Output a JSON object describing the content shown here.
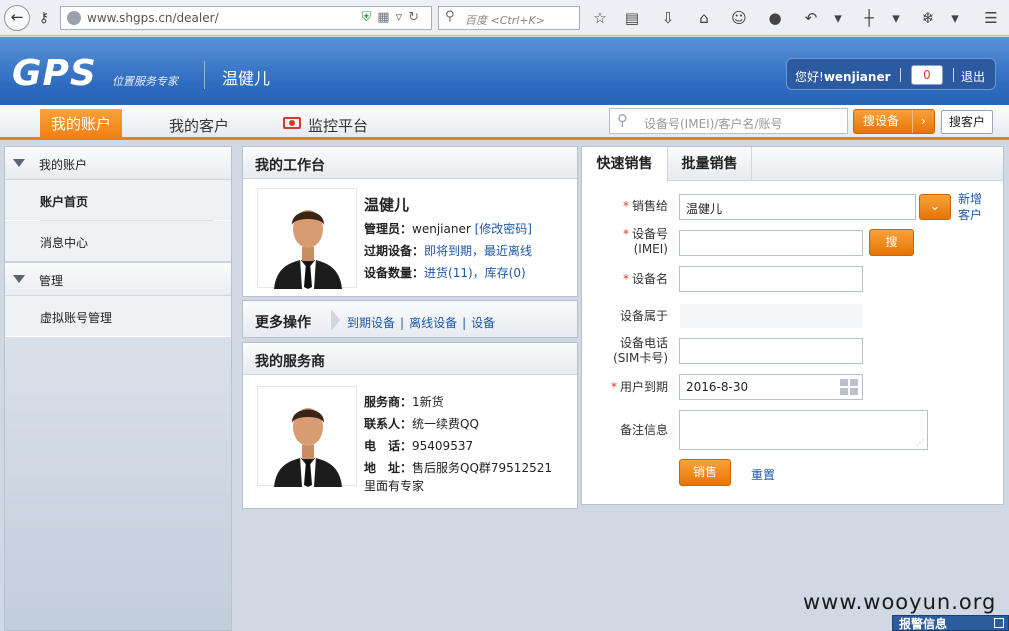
{
  "browser": {
    "url": "www.shgps.cn/dealer/",
    "search_placeholder": "百度 <Ctrl+K>"
  },
  "header": {
    "logo": "GPS",
    "logo_sub": "位置服务专家",
    "company": "温健儿",
    "greeting": "您好!",
    "username": "wenjianer",
    "badge_count": "0",
    "logout": "退出"
  },
  "menu": {
    "tabs": [
      {
        "label": "我的账户",
        "active": true
      },
      {
        "label": "我的客户",
        "active": false
      },
      {
        "label": "监控平台",
        "active": false
      }
    ],
    "search_placeholder": "设备号(IMEI)/客户名/账号",
    "search_button": "搜设备",
    "search_customer_button": "搜客户"
  },
  "sidebar": {
    "groups": [
      {
        "label": "我的账户",
        "items": [
          "账户首页",
          "消息中心"
        ]
      },
      {
        "label": "管理",
        "items": [
          "虚拟账号管理"
        ]
      }
    ]
  },
  "workbench": {
    "title": "我的工作台",
    "name": "温健儿",
    "admin_label": "管理员：",
    "admin_value": "wenjianer",
    "change_password": "[修改密码]",
    "expired_label": "过期设备：",
    "expired_soon": "即将到期",
    "recent_offline": "最近离线",
    "device_count_label": "设备数量：",
    "stock_in": "进货(11)",
    "inventory": "库存(0)"
  },
  "more_ops": {
    "title": "更多操作",
    "links": [
      "到期设备",
      "离线设备",
      "设备"
    ]
  },
  "service": {
    "title": "我的服务商",
    "provider_label": "服务商：",
    "provider_value": "1新货",
    "contact_label": "联系人：",
    "contact_value": "统一续费QQ",
    "phone_label": "电　话：",
    "phone_value": "95409537",
    "address_label": "地　址：",
    "address_value": "售后服务QQ群79512521",
    "address_cont": "里面有专家"
  },
  "sales_form": {
    "tabs": [
      "快速销售",
      "批量销售"
    ],
    "sell_to_label": "销售给",
    "sell_to_value": "温健儿",
    "add_customer": "新增客户",
    "imei_label_1": "设备号",
    "imei_label_2": "(IMEI)",
    "search_btn": "搜",
    "device_name_label": "设备名",
    "belongs_label": "设备属于",
    "phone_label_1": "设备电话",
    "phone_label_2": "(SIM卡号)",
    "expire_label": "用户到期",
    "expire_value": "2016-8-30",
    "notes_label": "备注信息",
    "submit": "销售",
    "reset": "重置"
  },
  "footer": {
    "watermark": "www.wooyun.org",
    "alarm": "报警信息"
  },
  "colors": {
    "accent_orange": "#f07d11",
    "header_blue": "#2e6bbf",
    "link_blue": "#1e58a8",
    "required_red": "#e03a2c"
  }
}
